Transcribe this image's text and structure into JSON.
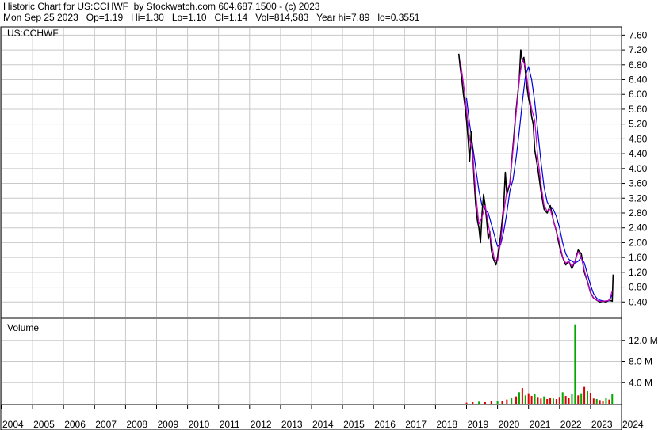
{
  "header": {
    "line1": "Historic Chart for US:CCHWF  by Stockwatch.com 604.687.1500 - (c) 2023",
    "line2": "Mon Sep 25 2023   Op=1.19   Hi=1.30   Lo=1.10   Cl=1.14   Vol=814,583   Year hi=7.89   lo=0.3551"
  },
  "colors": {
    "price": "#000000",
    "ma_short": "#cc00cc",
    "ma_long": "#0000dd",
    "volume_up": "#00aa00",
    "volume_down": "#dd0000",
    "grid": "#c8c8c8"
  },
  "chart_data": [
    {
      "type": "line",
      "title": "US:CCHWF",
      "ylim": [
        0,
        7.8
      ],
      "xlim": [
        2004.0,
        2024.0
      ],
      "y_ticks": [
        "7.60",
        "7.20",
        "6.80",
        "6.40",
        "6.00",
        "5.60",
        "5.20",
        "4.80",
        "4.40",
        "4.00",
        "3.60",
        "3.20",
        "2.80",
        "2.40",
        "2.00",
        "1.60",
        "1.20",
        "0.80",
        "0.40"
      ],
      "x_ticks": [
        "2004",
        "2005",
        "2006",
        "2007",
        "2008",
        "2009",
        "2010",
        "2011",
        "2012",
        "2013",
        "2014",
        "2015",
        "2016",
        "2017",
        "2018",
        "2019",
        "2020",
        "2021",
        "2022",
        "2023",
        "2024"
      ],
      "grid": true,
      "series": [
        {
          "key": "price",
          "x": [
            2018.75,
            2018.8,
            2018.85,
            2018.9,
            2018.95,
            2019.0,
            2019.05,
            2019.1,
            2019.15,
            2019.2,
            2019.25,
            2019.3,
            2019.35,
            2019.4,
            2019.45,
            2019.5,
            2019.55,
            2019.6,
            2019.65,
            2019.7,
            2019.75,
            2019.8,
            2019.85,
            2019.9,
            2019.95,
            2020.0,
            2020.1,
            2020.2,
            2020.25,
            2020.3,
            2020.4,
            2020.5,
            2020.6,
            2020.7,
            2020.75,
            2020.8,
            2020.85,
            2020.9,
            2020.95,
            2021.0,
            2021.05,
            2021.1,
            2021.15,
            2021.2,
            2021.3,
            2021.4,
            2021.5,
            2021.6,
            2021.7,
            2021.8,
            2021.9,
            2022.0,
            2022.1,
            2022.2,
            2022.3,
            2022.4,
            2022.5,
            2022.6,
            2022.7,
            2022.8,
            2022.9,
            2023.0,
            2023.1,
            2023.2,
            2023.3,
            2023.4,
            2023.5,
            2023.6,
            2023.7,
            2023.73
          ],
          "y": [
            7.1,
            6.7,
            6.4,
            6.0,
            5.7,
            5.3,
            4.8,
            4.2,
            5.0,
            4.4,
            3.6,
            3.0,
            2.6,
            2.4,
            2.0,
            2.8,
            3.3,
            3.0,
            2.6,
            2.1,
            2.3,
            1.8,
            1.6,
            1.5,
            1.4,
            1.6,
            2.2,
            3.0,
            3.9,
            3.3,
            3.6,
            4.6,
            5.6,
            6.4,
            7.2,
            6.9,
            7.0,
            6.6,
            6.2,
            5.9,
            5.7,
            5.4,
            5.2,
            4.5,
            4.0,
            3.4,
            2.9,
            2.8,
            3.0,
            2.6,
            2.3,
            1.9,
            1.6,
            1.4,
            1.5,
            1.3,
            1.5,
            1.8,
            1.7,
            1.2,
            0.95,
            0.65,
            0.5,
            0.45,
            0.4,
            0.42,
            0.4,
            0.45,
            0.42,
            1.14
          ]
        },
        {
          "key": "ma_short",
          "x": [
            2018.8,
            2018.9,
            2019.0,
            2019.1,
            2019.2,
            2019.3,
            2019.4,
            2019.5,
            2019.6,
            2019.7,
            2019.8,
            2019.9,
            2020.0,
            2020.1,
            2020.2,
            2020.3,
            2020.4,
            2020.5,
            2020.6,
            2020.7,
            2020.8,
            2020.9,
            2021.0,
            2021.1,
            2021.2,
            2021.3,
            2021.4,
            2021.5,
            2021.6,
            2021.7,
            2021.8,
            2021.9,
            2022.0,
            2022.1,
            2022.2,
            2022.3,
            2022.4,
            2022.5,
            2022.6,
            2022.7,
            2022.8,
            2022.9,
            2023.0,
            2023.1,
            2023.2,
            2023.3,
            2023.4,
            2023.5,
            2023.6,
            2023.7
          ],
          "y": [
            6.9,
            6.3,
            5.6,
            4.8,
            4.4,
            3.3,
            2.5,
            2.7,
            3.0,
            2.5,
            2.0,
            1.55,
            1.5,
            2.0,
            2.8,
            3.4,
            3.6,
            4.5,
            5.5,
            6.4,
            6.95,
            6.75,
            6.1,
            5.6,
            5.3,
            4.3,
            3.6,
            3.0,
            2.85,
            2.9,
            2.6,
            2.3,
            2.0,
            1.6,
            1.45,
            1.5,
            1.35,
            1.5,
            1.75,
            1.6,
            1.25,
            0.95,
            0.65,
            0.5,
            0.45,
            0.42,
            0.42,
            0.43,
            0.44,
            0.7
          ]
        },
        {
          "key": "ma_long",
          "x": [
            2019.0,
            2019.1,
            2019.2,
            2019.3,
            2019.4,
            2019.5,
            2019.6,
            2019.7,
            2019.8,
            2019.9,
            2020.0,
            2020.1,
            2020.2,
            2020.3,
            2020.4,
            2020.5,
            2020.6,
            2020.7,
            2020.8,
            2020.9,
            2021.0,
            2021.1,
            2021.2,
            2021.3,
            2021.4,
            2021.5,
            2021.6,
            2021.7,
            2021.8,
            2021.9,
            2022.0,
            2022.1,
            2022.2,
            2022.3,
            2022.4,
            2022.5,
            2022.6,
            2022.7,
            2022.8,
            2022.9,
            2023.0,
            2023.1,
            2023.2,
            2023.3,
            2023.4,
            2023.5,
            2023.6,
            2023.7
          ],
          "y": [
            5.9,
            5.2,
            4.6,
            4.0,
            3.4,
            3.0,
            2.9,
            2.8,
            2.5,
            2.2,
            1.9,
            1.95,
            2.3,
            2.8,
            3.4,
            3.7,
            4.3,
            5.0,
            5.8,
            6.5,
            6.75,
            6.4,
            5.8,
            5.0,
            4.2,
            3.5,
            3.1,
            2.95,
            2.9,
            2.7,
            2.4,
            2.0,
            1.7,
            1.55,
            1.5,
            1.45,
            1.5,
            1.6,
            1.45,
            1.15,
            0.85,
            0.62,
            0.5,
            0.45,
            0.43,
            0.42,
            0.43,
            0.6
          ]
        }
      ]
    },
    {
      "type": "bar",
      "title": "Volume",
      "ylim": [
        0,
        16
      ],
      "y_ticks": [
        "12.0 M",
        "8.0 M",
        "4.0 M"
      ],
      "unit": "M",
      "x": [
        2019.0,
        2019.2,
        2019.4,
        2019.6,
        2019.8,
        2020.0,
        2020.15,
        2020.3,
        2020.45,
        2020.6,
        2020.7,
        2020.8,
        2020.9,
        2021.0,
        2021.1,
        2021.2,
        2021.3,
        2021.4,
        2021.5,
        2021.6,
        2021.7,
        2021.8,
        2021.9,
        2022.0,
        2022.1,
        2022.2,
        2022.3,
        2022.4,
        2022.5,
        2022.6,
        2022.7,
        2022.8,
        2022.9,
        2023.0,
        2023.1,
        2023.2,
        2023.3,
        2023.4,
        2023.5,
        2023.6,
        2023.7
      ],
      "values": [
        0.2,
        0.3,
        0.4,
        0.3,
        0.5,
        0.6,
        0.5,
        0.8,
        1.1,
        1.4,
        2.2,
        3.0,
        1.6,
        2.0,
        1.5,
        1.8,
        1.3,
        1.0,
        1.4,
        0.9,
        1.2,
        1.0,
        0.9,
        1.3,
        2.2,
        1.5,
        1.1,
        1.8,
        15.0,
        1.6,
        2.0,
        3.2,
        2.4,
        2.1,
        1.0,
        0.9,
        0.7,
        0.6,
        1.2,
        0.8,
        1.8
      ],
      "colors": [
        "down",
        "down",
        "up",
        "down",
        "down",
        "up",
        "down",
        "down",
        "up",
        "down",
        "up",
        "down",
        "up",
        "down",
        "down",
        "up",
        "down",
        "down",
        "up",
        "down",
        "down",
        "up",
        "down",
        "down",
        "up",
        "down",
        "down",
        "up",
        "up",
        "down",
        "up",
        "down",
        "up",
        "down",
        "down",
        "up",
        "down",
        "down",
        "up",
        "down",
        "up"
      ]
    }
  ]
}
